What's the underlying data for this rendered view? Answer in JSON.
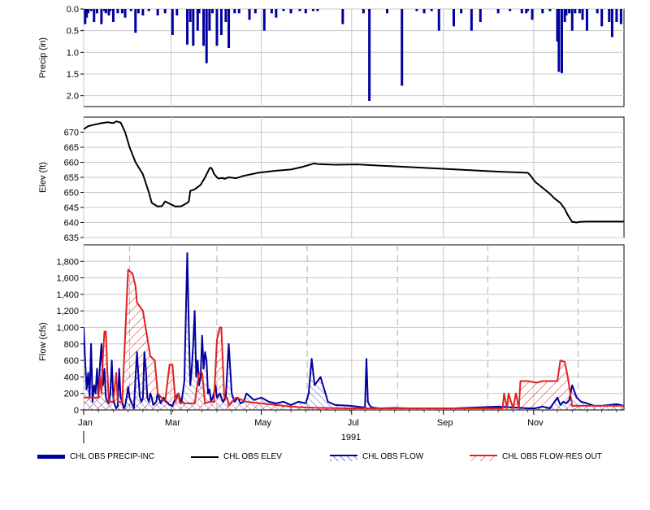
{
  "colors": {
    "precip": "#0000A0",
    "elev": "#000000",
    "flow": "#0000A0",
    "res_out": "#E02020",
    "grid": "#C8C8C8"
  },
  "year_label": "1991",
  "chart_data": [
    {
      "type": "bar",
      "name": "precip",
      "ylabel": "Precip (in)",
      "ylim": [
        0,
        2.25
      ],
      "y_inverted": true,
      "y_ticks": [
        "0.0",
        "0.5",
        "1.0",
        "1.5",
        "2.0"
      ],
      "y_tick_values": [
        0,
        0.5,
        1.0,
        1.5,
        2.0
      ],
      "x_months": [
        "Jan",
        "Mar",
        "May",
        "Jul",
        "Sep",
        "Nov"
      ],
      "x_range_days": [
        0,
        365
      ],
      "grid": true,
      "series": [
        {
          "name": "CHL OBS PRECIP-INC",
          "days": [
            1,
            2,
            3,
            5,
            7,
            9,
            12,
            14,
            15,
            17,
            18,
            20,
            23,
            26,
            28,
            32,
            35,
            37,
            40,
            44,
            50,
            55,
            60,
            63,
            70,
            72,
            74,
            77,
            78,
            81,
            83,
            85,
            87,
            90,
            93,
            96,
            98,
            102,
            105,
            112,
            116,
            122,
            127,
            130,
            135,
            140,
            146,
            150,
            155,
            158,
            175,
            189,
            193,
            205,
            215,
            225,
            230,
            235,
            240,
            250,
            255,
            262,
            268,
            280,
            288,
            296,
            299,
            300,
            303,
            310,
            315,
            320,
            321,
            323,
            325,
            326,
            328,
            330,
            332,
            335,
            337,
            340,
            347,
            350,
            355,
            357,
            360,
            363
          ],
          "values": [
            0.35,
            0.2,
            0.1,
            0.05,
            0.3,
            0.1,
            0.35,
            0.05,
            0.1,
            0.15,
            0.05,
            0.3,
            0.1,
            0.1,
            0.2,
            0.05,
            0.55,
            0.1,
            0.15,
            0.05,
            0.15,
            0.1,
            0.6,
            0.15,
            0.82,
            0.3,
            0.85,
            0.5,
            0.1,
            0.85,
            1.25,
            0.5,
            0.1,
            0.85,
            0.6,
            0.3,
            0.9,
            0.1,
            0.1,
            0.25,
            0.1,
            0.5,
            0.1,
            0.2,
            0.05,
            0.1,
            0.05,
            0.1,
            0.05,
            0.05,
            0.35,
            0.1,
            2.12,
            0.1,
            1.77,
            0.05,
            0.1,
            0.05,
            0.5,
            0.4,
            0.1,
            0.5,
            0.3,
            0.1,
            0.05,
            0.1,
            0.1,
            0.05,
            0.25,
            0.1,
            0.05,
            0.75,
            1.45,
            1.48,
            0.3,
            0.15,
            0.1,
            0.5,
            0.1,
            0.1,
            0.25,
            0.5,
            0.1,
            0.4,
            0.3,
            0.65,
            0.3,
            0.35
          ]
        }
      ]
    },
    {
      "type": "line",
      "name": "elev",
      "ylabel": "Elev (ft)",
      "ylim": [
        635,
        675
      ],
      "y_ticks": [
        "635",
        "640",
        "645",
        "650",
        "655",
        "660",
        "665",
        "670"
      ],
      "y_tick_values": [
        635,
        640,
        645,
        650,
        655,
        660,
        665,
        670
      ],
      "grid": true,
      "series": [
        {
          "name": "CHL OBS ELEV",
          "x": [
            0,
            3,
            7,
            12,
            16,
            20,
            22,
            25,
            28,
            31,
            35,
            40,
            44,
            46,
            50,
            53,
            55,
            59,
            62,
            66,
            70,
            71,
            72,
            75,
            79,
            82,
            85,
            86,
            87,
            88,
            90,
            91,
            94,
            95,
            98,
            103,
            108,
            118,
            130,
            140,
            148,
            155,
            156,
            158,
            170,
            185,
            200,
            220,
            240,
            260,
            280,
            300,
            302,
            305,
            310,
            315,
            318,
            322,
            325,
            327,
            330,
            333,
            335,
            340,
            350,
            365
          ],
          "y": [
            671,
            672,
            672.5,
            673,
            673.3,
            673,
            673.6,
            673.2,
            670,
            665,
            660,
            656,
            650,
            646.5,
            645.3,
            645.5,
            647,
            646,
            645.3,
            645.4,
            646.5,
            647,
            650.5,
            651,
            652.5,
            655,
            658,
            658.2,
            657.5,
            656.2,
            655,
            654.6,
            654.8,
            654.5,
            655,
            654.7,
            655.5,
            656.5,
            657.2,
            657.6,
            658.5,
            659.5,
            659.6,
            659.4,
            659.2,
            659.3,
            658.9,
            658.4,
            657.9,
            657.4,
            656.9,
            656.5,
            655.5,
            653.5,
            651.5,
            649.5,
            648,
            646.5,
            644.5,
            642.5,
            640.2,
            640,
            640.2,
            640.3,
            640.3,
            640.3
          ]
        }
      ]
    },
    {
      "type": "area",
      "name": "flow",
      "ylabel": "Flow (cfs)",
      "ylim": [
        0,
        2000
      ],
      "y_ticks": [
        "0",
        "200",
        "400",
        "600",
        "800",
        "1,000",
        "1,200",
        "1,400",
        "1,600",
        "1,800"
      ],
      "y_tick_values": [
        0,
        200,
        400,
        600,
        800,
        1000,
        1200,
        1400,
        1600,
        1800
      ],
      "grid": true,
      "series": [
        {
          "name": "CHL OBS FLOW",
          "x": [
            0,
            1,
            2,
            3,
            4,
            5,
            6,
            7,
            8,
            9,
            10,
            11,
            12,
            13,
            14,
            15,
            16,
            17,
            18,
            19,
            20,
            21,
            22,
            23,
            24,
            25,
            26,
            27,
            28,
            29,
            30,
            31,
            32,
            33,
            34,
            35,
            36,
            37,
            38,
            39,
            40,
            41,
            42,
            43,
            44,
            45,
            46,
            47,
            48,
            49,
            50,
            52,
            54,
            56,
            58,
            60,
            62,
            64,
            66,
            68,
            70,
            71,
            72,
            73,
            74,
            75,
            76,
            77,
            78,
            79,
            80,
            81,
            82,
            83,
            84,
            85,
            86,
            87,
            88,
            89,
            90,
            92,
            94,
            96,
            98,
            100,
            102,
            104,
            106,
            108,
            110,
            115,
            120,
            125,
            130,
            135,
            140,
            145,
            150,
            152,
            154,
            156,
            158,
            160,
            165,
            170,
            180,
            190,
            191,
            192,
            193,
            194,
            195,
            200,
            210,
            220,
            250,
            280,
            300,
            305,
            310,
            315,
            320,
            322,
            324,
            326,
            328,
            330,
            333,
            336,
            340,
            345,
            350,
            355,
            360,
            365
          ],
          "y": [
            1000,
            600,
            250,
            450,
            150,
            800,
            100,
            300,
            200,
            500,
            150,
            550,
            800,
            300,
            500,
            150,
            100,
            80,
            200,
            600,
            150,
            60,
            20,
            50,
            500,
            150,
            100,
            20,
            50,
            150,
            280,
            150,
            100,
            60,
            20,
            400,
            700,
            400,
            150,
            100,
            150,
            700,
            500,
            150,
            100,
            200,
            150,
            60,
            80,
            100,
            200,
            80,
            150,
            100,
            60,
            50,
            150,
            200,
            80,
            350,
            1900,
            1000,
            300,
            500,
            800,
            1200,
            400,
            600,
            300,
            400,
            900,
            500,
            700,
            600,
            200,
            250,
            100,
            150,
            200,
            300,
            150,
            200,
            100,
            150,
            800,
            200,
            100,
            150,
            80,
            100,
            200,
            120,
            150,
            100,
            80,
            100,
            60,
            100,
            80,
            200,
            620,
            300,
            350,
            400,
            100,
            60,
            50,
            30,
            620,
            100,
            60,
            40,
            30,
            20,
            25,
            20,
            20,
            40,
            20,
            20,
            40,
            20,
            150,
            60,
            100,
            80,
            120,
            300,
            150,
            100,
            80,
            50,
            50,
            60,
            70,
            50
          ]
        },
        {
          "name": "CHL OBS FLOW-RES OUT",
          "x": [
            0,
            5,
            10,
            11,
            12,
            13,
            14,
            15,
            16,
            17,
            18,
            20,
            22,
            23,
            24,
            25,
            26,
            30,
            33,
            35,
            36,
            40,
            45,
            48,
            50,
            55,
            58,
            60,
            62,
            64,
            65,
            67,
            68,
            70,
            72,
            75,
            78,
            80,
            82,
            85,
            88,
            90,
            92,
            93,
            95,
            97,
            98,
            100,
            103,
            110,
            120,
            130,
            140,
            150,
            160,
            180,
            200,
            250,
            280,
            283,
            284,
            286,
            287,
            290,
            292,
            294,
            295,
            297,
            300,
            306,
            310,
            313,
            316,
            320,
            322,
            325,
            327,
            330,
            333,
            335,
            340,
            350,
            360,
            365
          ],
          "y": [
            150,
            150,
            150,
            400,
            200,
            650,
            950,
            950,
            450,
            100,
            100,
            100,
            450,
            100,
            100,
            100,
            100,
            1700,
            1650,
            1500,
            1300,
            1200,
            650,
            600,
            200,
            100,
            550,
            550,
            100,
            200,
            80,
            100,
            80,
            80,
            80,
            80,
            450,
            450,
            80,
            100,
            100,
            850,
            1000,
            1000,
            150,
            150,
            50,
            100,
            150,
            100,
            80,
            60,
            40,
            30,
            25,
            20,
            20,
            20,
            20,
            20,
            200,
            20,
            200,
            20,
            200,
            20,
            350,
            350,
            350,
            330,
            350,
            350,
            350,
            350,
            600,
            580,
            400,
            50,
            50,
            50,
            50,
            50,
            50,
            50
          ]
        }
      ]
    }
  ],
  "legend": [
    {
      "label": "CHL OBS PRECIP-INC",
      "icon": "thick-blue-bar-swatch"
    },
    {
      "label": "CHL OBS ELEV",
      "icon": "black-line-swatch"
    },
    {
      "label": "CHL OBS FLOW",
      "icon": "blue-hatch-swatch"
    },
    {
      "label": "CHL OBS FLOW-RES OUT",
      "icon": "red-hatch-swatch"
    }
  ]
}
